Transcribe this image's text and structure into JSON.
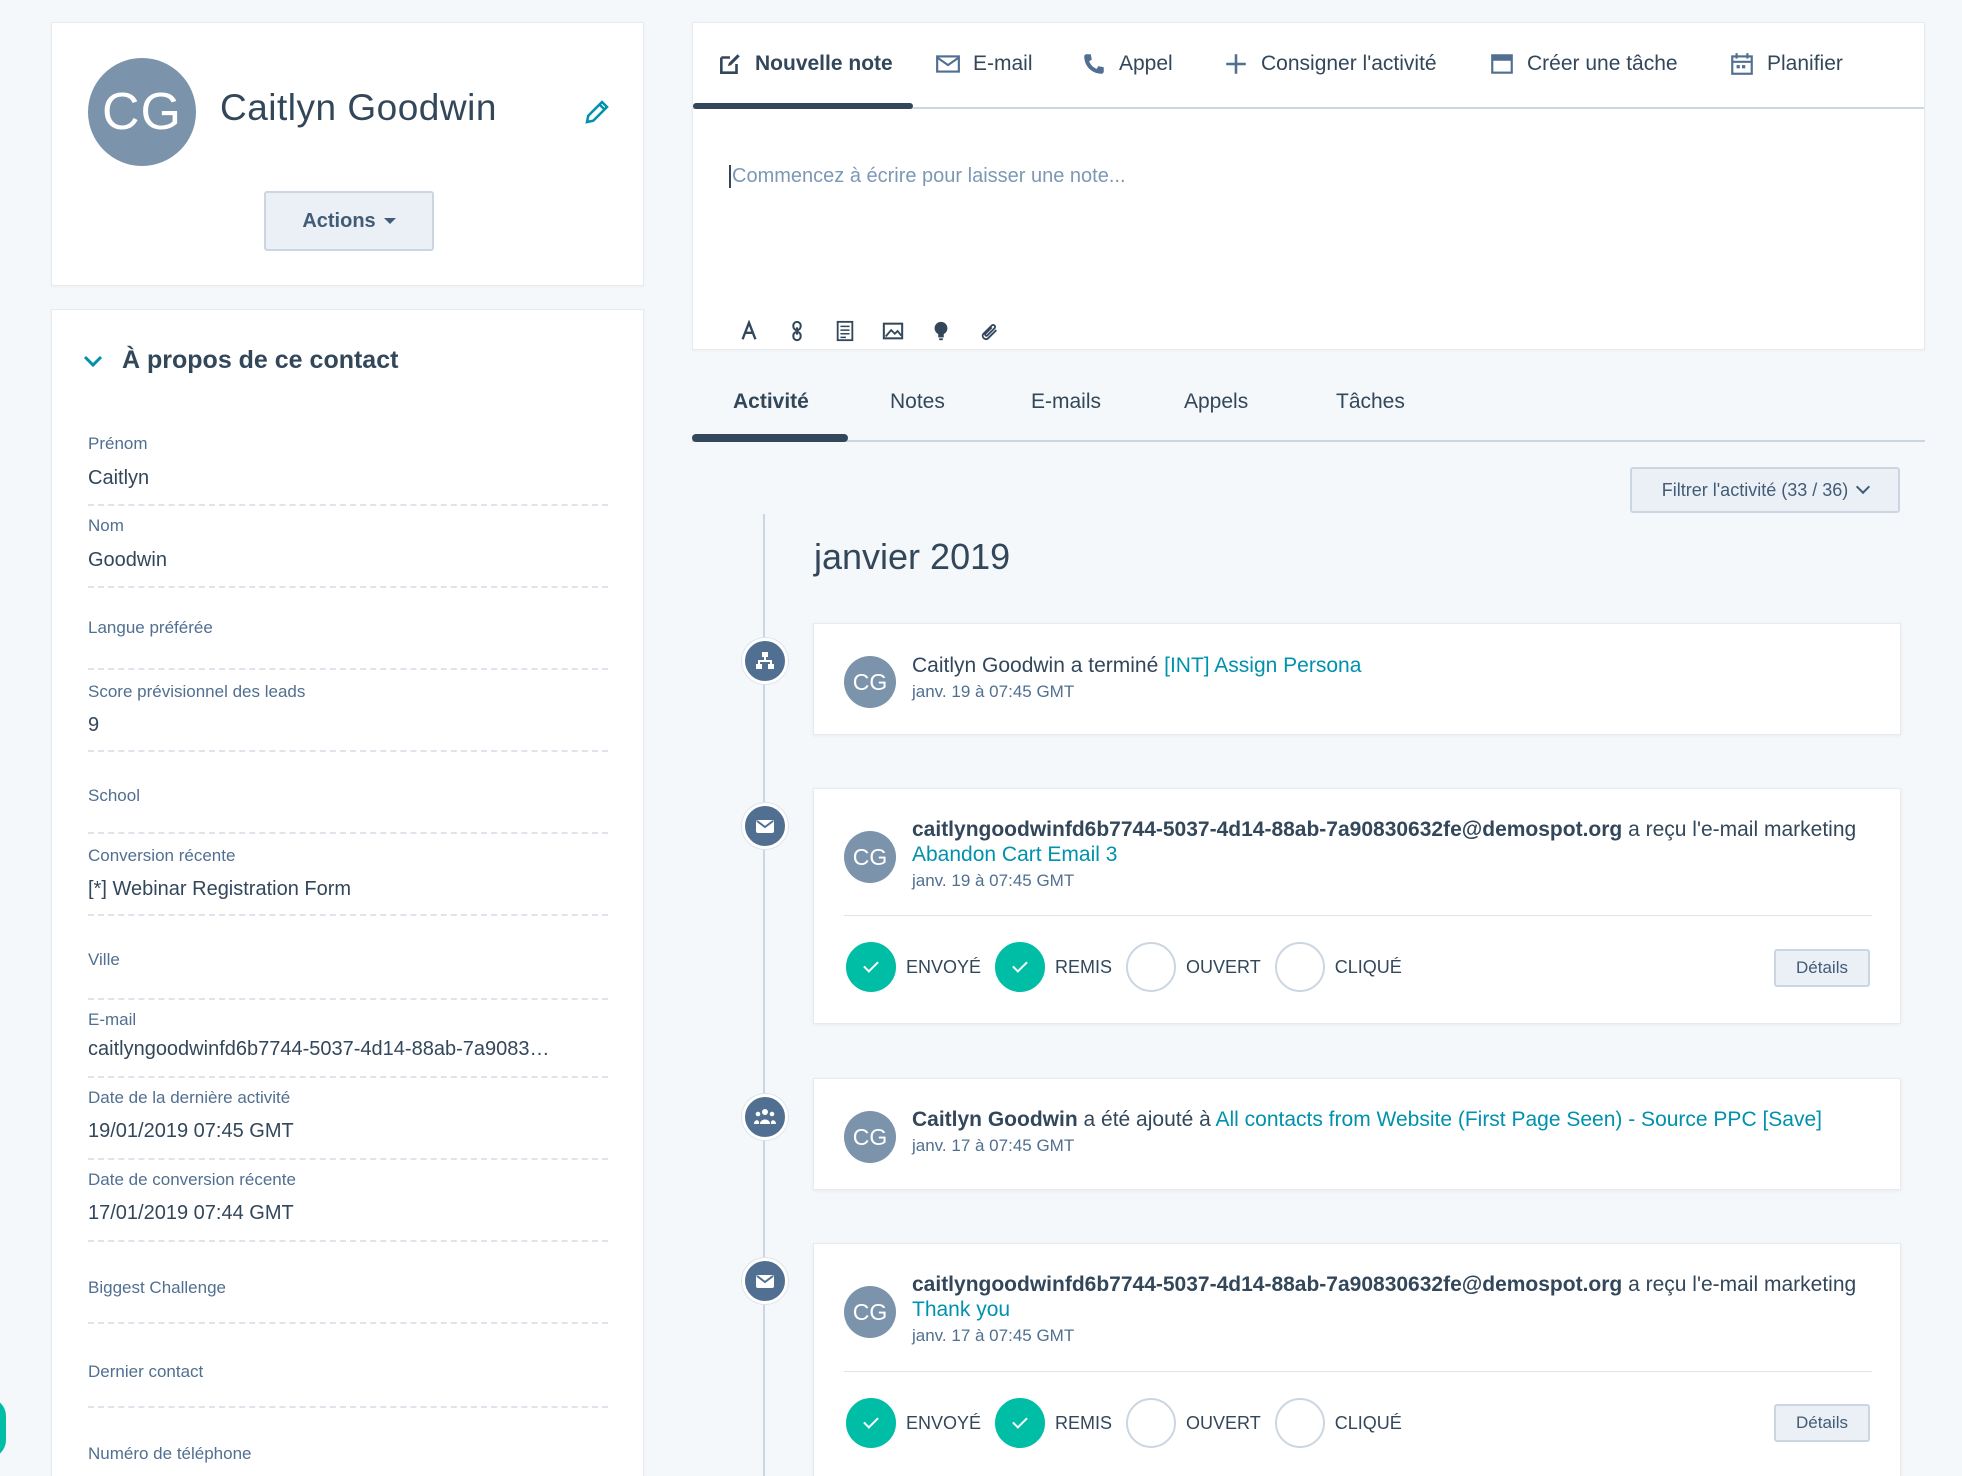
{
  "contact": {
    "initials": "CG",
    "name": "Caitlyn Goodwin",
    "actions_label": "Actions"
  },
  "about": {
    "title": "À propos de ce contact",
    "properties": [
      {
        "label": "Prénom",
        "value": "Caitlyn"
      },
      {
        "label": "Nom",
        "value": "Goodwin"
      },
      {
        "label": "Langue préférée",
        "value": ""
      },
      {
        "label": "Score prévisionnel des leads",
        "value": "9"
      },
      {
        "label": "School",
        "value": ""
      },
      {
        "label": "Conversion récente",
        "value": "[*] Webinar Registration Form"
      },
      {
        "label": "Ville",
        "value": ""
      },
      {
        "label": "E-mail",
        "value": "caitlyngoodwinfd6b7744-5037-4d14-88ab-7a9083…"
      },
      {
        "label": "Date de la dernière activité",
        "value": "19/01/2019 07:45 GMT"
      },
      {
        "label": "Date de conversion récente",
        "value": "17/01/2019 07:44 GMT"
      },
      {
        "label": "Biggest Challenge",
        "value": ""
      },
      {
        "label": "Dernier contact",
        "value": ""
      },
      {
        "label": "Numéro de téléphone",
        "value": ""
      }
    ]
  },
  "composer": {
    "tabs": [
      {
        "label": "Nouvelle note",
        "icon": "edit-note-icon"
      },
      {
        "label": "E-mail",
        "icon": "envelope-icon"
      },
      {
        "label": "Appel",
        "icon": "phone-icon"
      },
      {
        "label": "Consigner l'activité",
        "icon": "plus-icon"
      },
      {
        "label": "Créer une tâche",
        "icon": "task-icon"
      },
      {
        "label": "Planifier",
        "icon": "calendar-icon"
      }
    ],
    "placeholder": "Commencez à écrire pour laisser une note..."
  },
  "timeline": {
    "tabs": [
      "Activité",
      "Notes",
      "E-mails",
      "Appels",
      "Tâches"
    ],
    "filter_label": "Filtrer l'activité (33 / 36)",
    "month": "janvier 2019",
    "items": [
      {
        "icon": "workflow-icon",
        "actor": "Caitlyn Goodwin",
        "verb": " a terminé ",
        "link": "[INT] Assign Persona",
        "time": "janv. 19 à 07:45 GMT"
      },
      {
        "icon": "envelope-icon",
        "actor": "caitlyngoodwinfd6b7744-5037-4d14-88ab-7a90830632fe@demospot.org",
        "verb": " a reçu l'e-mail marketing ",
        "link": "Abandon Cart Email 3",
        "time": "janv. 19 à 07:45 GMT",
        "statuses": [
          "ENVOYÉ",
          "REMIS",
          "OUVERT",
          "CLIQUÉ"
        ],
        "details": "Détails"
      },
      {
        "icon": "list-members-icon",
        "actor": "Caitlyn Goodwin",
        "verb": " a été ajouté à ",
        "link": "All contacts from Website (First Page Seen) - Source PPC [Save]",
        "time": "janv. 17 à 07:45 GMT"
      },
      {
        "icon": "envelope-icon",
        "actor": "caitlyngoodwinfd6b7744-5037-4d14-88ab-7a90830632fe@demospot.org",
        "verb": " a reçu l'e-mail marketing ",
        "link": "Thank you",
        "time": "janv. 17 à 07:45 GMT",
        "statuses": [
          "ENVOYÉ",
          "REMIS",
          "OUVERT",
          "CLIQUÉ"
        ],
        "details": "Détails"
      }
    ]
  },
  "colors": {
    "accent_teal": "#00bda5",
    "link": "#0091ae",
    "text": "#33475b"
  }
}
